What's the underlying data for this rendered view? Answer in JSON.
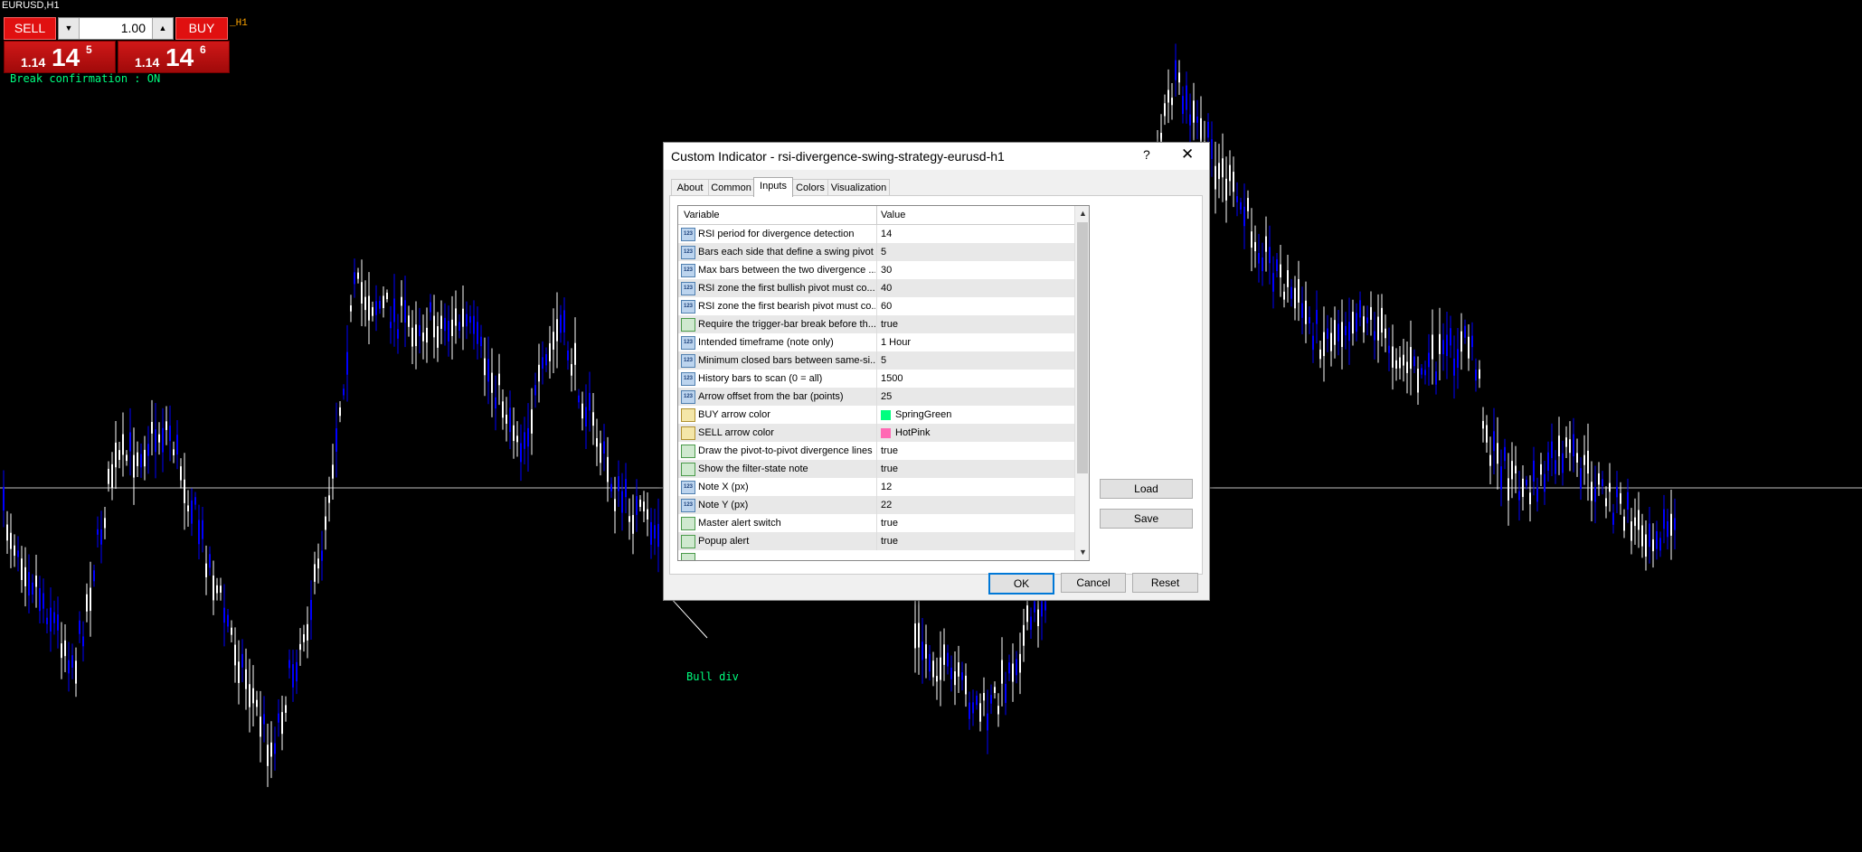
{
  "chart": {
    "symbol": "EURUSD,H1",
    "h1_label": "_H1",
    "break_note": "Break confirmation : ON",
    "bull_div_label": "Bull div"
  },
  "trade": {
    "sell_label": "SELL",
    "buy_label": "BUY",
    "lot": "1.00",
    "sell_price_small": "1.14",
    "sell_price_big": "14",
    "sell_price_sup": "5",
    "buy_price_small": "1.14",
    "buy_price_big": "14",
    "buy_price_sup": "6"
  },
  "dialog": {
    "title": "Custom Indicator - rsi-divergence-swing-strategy-eurusd-h1",
    "help": "?",
    "close": "✕",
    "tabs": [
      "About",
      "Common",
      "Inputs",
      "Colors",
      "Visualization"
    ],
    "active_tab": "Inputs",
    "col_variable": "Variable",
    "col_value": "Value",
    "rows": [
      {
        "icon": "123",
        "name": "RSI period for divergence detection",
        "value": "14"
      },
      {
        "icon": "123",
        "name": "Bars each side that define a swing pivot",
        "value": "5"
      },
      {
        "icon": "123",
        "name": "Max bars between the two divergence ...",
        "value": "30"
      },
      {
        "icon": "123",
        "name": "RSI zone the first bullish pivot must co...",
        "value": "40"
      },
      {
        "icon": "123",
        "name": "RSI zone the first bearish pivot must co...",
        "value": "60"
      },
      {
        "icon": "bool",
        "name": "Require the trigger-bar break before th...",
        "value": "true"
      },
      {
        "icon": "123",
        "name": "Intended timeframe (note only)",
        "value": "1 Hour"
      },
      {
        "icon": "123",
        "name": "Minimum closed bars between same-si...",
        "value": "5"
      },
      {
        "icon": "123",
        "name": "History bars to scan (0 = all)",
        "value": "1500"
      },
      {
        "icon": "123",
        "name": "Arrow offset from the bar (points)",
        "value": "25"
      },
      {
        "icon": "color",
        "name": "BUY arrow color",
        "value": "SpringGreen",
        "swatch": "#00ff7f"
      },
      {
        "icon": "color",
        "name": "SELL arrow color",
        "value": "HotPink",
        "swatch": "#ff69b4"
      },
      {
        "icon": "bool",
        "name": "Draw the pivot-to-pivot divergence lines",
        "value": "true"
      },
      {
        "icon": "bool",
        "name": "Show the filter-state note",
        "value": "true"
      },
      {
        "icon": "123",
        "name": "Note X (px)",
        "value": "12"
      },
      {
        "icon": "123",
        "name": "Note Y (px)",
        "value": "22"
      },
      {
        "icon": "bool",
        "name": "Master alert switch",
        "value": "true"
      },
      {
        "icon": "bool",
        "name": "Popup alert",
        "value": "true"
      }
    ],
    "load": "Load",
    "save": "Save",
    "ok": "OK",
    "cancel": "Cancel",
    "reset": "Reset"
  },
  "colors": {
    "bull_candle": "#ffffff",
    "bear_candle": "#0000ff",
    "accent_green": "#00ff7f"
  }
}
